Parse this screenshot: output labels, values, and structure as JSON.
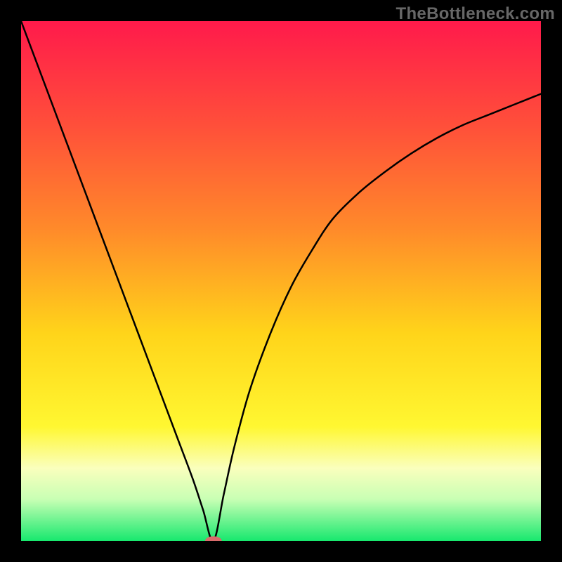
{
  "watermark": "TheBottleneck.com",
  "colors": {
    "frame": "#000000",
    "watermark_text": "#676767",
    "curve": "#000000",
    "marker_fill": "#d96b6b",
    "gradient_stops": [
      {
        "offset": 0.0,
        "color": "#ff1a4b"
      },
      {
        "offset": 0.2,
        "color": "#ff4f3a"
      },
      {
        "offset": 0.4,
        "color": "#ff8a2a"
      },
      {
        "offset": 0.6,
        "color": "#ffd41a"
      },
      {
        "offset": 0.78,
        "color": "#fff731"
      },
      {
        "offset": 0.86,
        "color": "#faffbd"
      },
      {
        "offset": 0.92,
        "color": "#c8ffb4"
      },
      {
        "offset": 1.0,
        "color": "#17e86e"
      }
    ]
  },
  "chart_data": {
    "type": "line",
    "title": "",
    "xlabel": "",
    "ylabel": "",
    "xlim": [
      0,
      100
    ],
    "ylim": [
      0,
      100
    ],
    "optimum_x": 37,
    "series": [
      {
        "name": "bottleneck-curve",
        "x": [
          0,
          3,
          6,
          9,
          12,
          15,
          18,
          21,
          24,
          27,
          30,
          33,
          35,
          37,
          39,
          41,
          44,
          48,
          52,
          56,
          60,
          65,
          70,
          75,
          80,
          85,
          90,
          95,
          100
        ],
        "values": [
          100,
          92,
          84,
          76,
          68,
          60,
          52,
          44,
          36,
          28,
          20,
          12,
          6,
          0,
          9,
          18,
          29,
          40,
          49,
          56,
          62,
          67,
          71,
          74.5,
          77.5,
          80,
          82,
          84,
          86
        ]
      }
    ],
    "marker": {
      "x": 37,
      "y": 0,
      "rx": 1.6,
      "ry": 0.9
    }
  }
}
